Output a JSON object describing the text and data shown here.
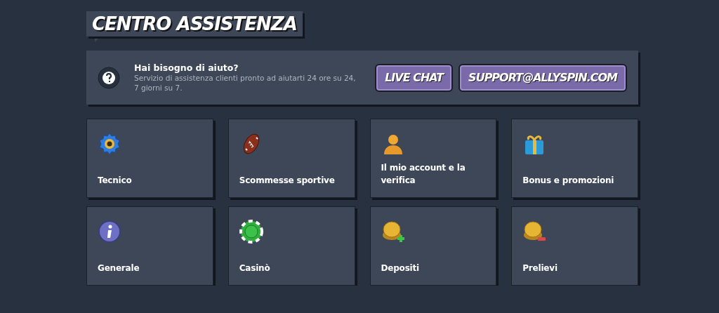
{
  "title": "CENTRO ASSISTENZA",
  "help": {
    "heading": "Hai bisogno di aiuto?",
    "text": "Servizio di assistenza clienti pronto ad aiutarti 24 ore su 24, 7 giorni su 7.",
    "buttons": [
      "LIVE CHAT",
      "SUPPORT@ALLYSPIN.COM"
    ]
  },
  "categories": [
    {
      "label": "Tecnico",
      "kind": "gear"
    },
    {
      "label": "Scommesse sportive",
      "kind": "football"
    },
    {
      "label": "Il mio account e la verifica",
      "kind": "person"
    },
    {
      "label": "Bonus e promozioni",
      "kind": "gift"
    },
    {
      "label": "Generale",
      "kind": "info"
    },
    {
      "label": "Casinò",
      "kind": "chip"
    },
    {
      "label": "Depositi",
      "kind": "coin-plus"
    },
    {
      "label": "Prelievi",
      "kind": "coin-minus"
    }
  ]
}
